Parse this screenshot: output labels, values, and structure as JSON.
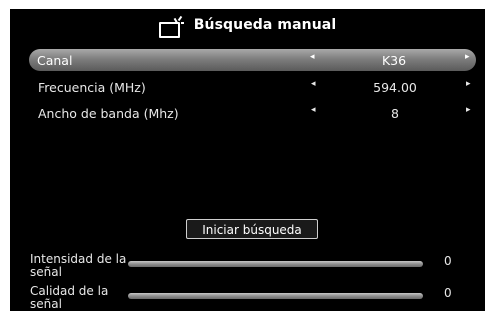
{
  "header": {
    "title": "Búsqueda manual",
    "icon": "tv-antenna-icon"
  },
  "settings": [
    {
      "label": "Canal",
      "value": "K36",
      "selected": true
    },
    {
      "label": "Frecuencia (MHz)",
      "value": "594.00",
      "selected": false
    },
    {
      "label": "Ancho de banda (Mhz)",
      "value": "8",
      "selected": false
    }
  ],
  "arrows": {
    "left": "◂",
    "right": "▸"
  },
  "actions": {
    "start_search_label": "Iniciar búsqueda"
  },
  "meters": {
    "signal_strength": {
      "label": "Intensidad de la señal",
      "value": "0",
      "level_percent": 0
    },
    "signal_quality": {
      "label": "Calidad de la señal",
      "value": "0",
      "level_percent": 0
    }
  },
  "colors": {
    "background": "#000000",
    "selected_row_top": "#a9a9a9",
    "selected_row_bottom": "#5a5a5a",
    "text": "#e8e8e8",
    "meter_track": "#9a9a9a"
  }
}
